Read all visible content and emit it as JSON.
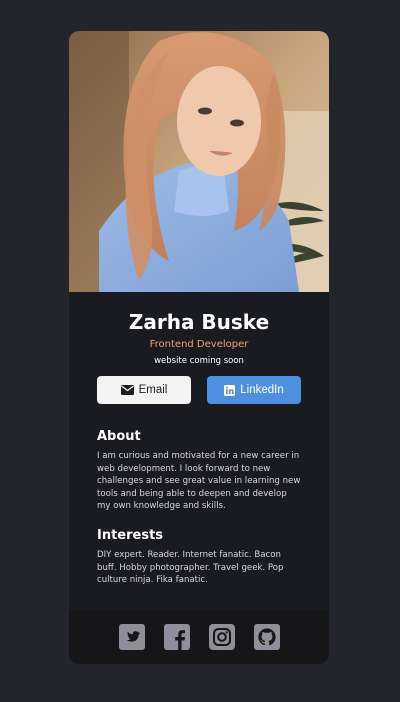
{
  "profile": {
    "name": "Zarha Buske",
    "role": "Frontend Developer",
    "website": "website coming soon"
  },
  "buttons": {
    "email_label": "Email",
    "email_icon": "envelope-icon",
    "linkedin_label": "LinkedIn",
    "linkedin_icon": "linkedin-icon"
  },
  "about": {
    "heading": "About",
    "text": "I am curious and motivated for a new career in web development. I look forward to new challenges and see great value in learning new tools and being able to deepen and develop my own knowledge and skills."
  },
  "interests": {
    "heading": "Interests",
    "text": "DIY expert. Reader. Internet fanatic. Bacon buff. Hobby photographer. Travel geek. Pop culture ninja. Fika fanatic."
  },
  "footer": {
    "social_icons": [
      "twitter-icon",
      "facebook-icon",
      "instagram-icon",
      "github-icon"
    ]
  },
  "colors": {
    "page_background": "#23252c",
    "card_background": "#1a1b21",
    "footer_background": "#161619",
    "accent_orange": "#f2a36b",
    "linkedin_blue": "#4e8fde",
    "social_icon_gray": "#918e9b"
  }
}
